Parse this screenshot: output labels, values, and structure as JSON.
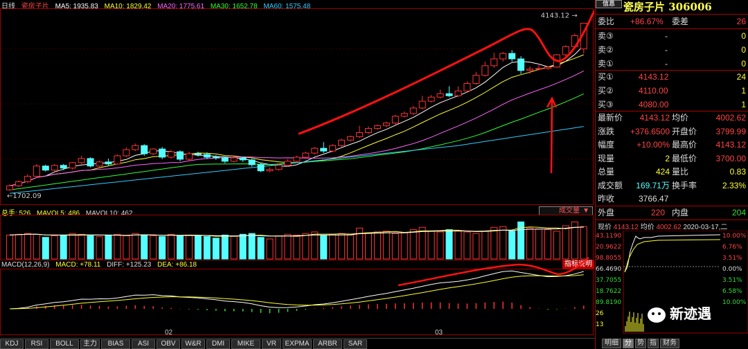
{
  "header": {
    "period": "日线",
    "stock": "瓷房子片",
    "ma": [
      {
        "label": "MA5: 1935.83",
        "color": "#ffffff"
      },
      {
        "label": "MA10: 1829.42",
        "color": "#ffff33"
      },
      {
        "label": "MA20: 1775.61",
        "color": "#ff66ff"
      },
      {
        "label": "MA30: 1652.78",
        "color": "#33ff33"
      },
      {
        "label": "MA60: 1575.48",
        "color": "#33ccff"
      }
    ]
  },
  "kline": {
    "high_label": "4143.12",
    "low_label": "1702.09",
    "candles": [
      [
        1702,
        1760,
        1690,
        1780
      ],
      [
        1760,
        1820,
        1740,
        1840
      ],
      [
        1820,
        1900,
        1800,
        1930
      ],
      [
        1900,
        2050,
        1880,
        2080
      ],
      [
        2050,
        1990,
        1970,
        2070
      ],
      [
        1990,
        2060,
        1970,
        2080
      ],
      [
        2060,
        2020,
        1990,
        2080
      ],
      [
        2020,
        2100,
        2000,
        2110
      ],
      [
        2100,
        2160,
        2080,
        2200
      ],
      [
        2160,
        2050,
        2030,
        2180
      ],
      [
        2050,
        2110,
        2040,
        2130
      ],
      [
        2110,
        2080,
        2060,
        2160
      ],
      [
        2080,
        2200,
        2070,
        2220
      ],
      [
        2200,
        2290,
        2180,
        2320
      ],
      [
        2290,
        2350,
        2270,
        2380
      ],
      [
        2350,
        2230,
        2200,
        2370
      ],
      [
        2230,
        2300,
        2210,
        2310
      ],
      [
        2300,
        2180,
        2150,
        2330
      ],
      [
        2180,
        2260,
        2160,
        2280
      ],
      [
        2260,
        2150,
        2120,
        2280
      ],
      [
        2150,
        2230,
        2120,
        2260
      ],
      [
        2230,
        2220,
        2190,
        2260
      ],
      [
        2220,
        2180,
        2150,
        2250
      ],
      [
        2180,
        2170,
        2140,
        2210
      ],
      [
        2170,
        2120,
        2090,
        2190
      ],
      [
        2120,
        2170,
        2100,
        2190
      ],
      [
        2170,
        2140,
        2110,
        2190
      ],
      [
        2140,
        2070,
        2040,
        2160
      ],
      [
        2070,
        1980,
        1960,
        2090
      ],
      [
        1980,
        2000,
        1960,
        2030
      ],
      [
        2000,
        2060,
        1980,
        2080
      ],
      [
        2060,
        2120,
        2040,
        2150
      ],
      [
        2120,
        2180,
        2100,
        2200
      ],
      [
        2180,
        2240,
        2160,
        2260
      ],
      [
        2240,
        2310,
        2220,
        2330
      ],
      [
        2310,
        2270,
        2240,
        2400
      ],
      [
        2270,
        2350,
        2250,
        2370
      ],
      [
        2350,
        2430,
        2330,
        2450
      ],
      [
        2430,
        2480,
        2410,
        2500
      ],
      [
        2480,
        2540,
        2460,
        2640
      ],
      [
        2540,
        2600,
        2520,
        2630
      ],
      [
        2600,
        2640,
        2580,
        2660
      ],
      [
        2640,
        2680,
        2620,
        2700
      ],
      [
        2680,
        2780,
        2660,
        2800
      ],
      [
        2780,
        2820,
        2760,
        2850
      ],
      [
        2820,
        2900,
        2800,
        2930
      ],
      [
        2900,
        3000,
        2880,
        3080
      ],
      [
        3000,
        3060,
        2980,
        3090
      ],
      [
        3060,
        3110,
        3040,
        3170
      ],
      [
        3110,
        3080,
        3060,
        3220
      ],
      [
        3080,
        3150,
        3060,
        3220
      ],
      [
        3150,
        3260,
        3130,
        3290
      ],
      [
        3260,
        3380,
        3240,
        3430
      ],
      [
        3380,
        3520,
        3360,
        3580
      ],
      [
        3520,
        3620,
        3490,
        3710
      ],
      [
        3620,
        3700,
        3580,
        3720
      ],
      [
        3700,
        3620,
        3580,
        3750
      ],
      [
        3620,
        3450,
        3400,
        3660
      ],
      [
        3450,
        3470,
        3400,
        3510
      ],
      [
        3470,
        3480,
        3450,
        3550
      ],
      [
        3480,
        3500,
        3460,
        3510
      ],
      [
        3500,
        3680,
        3490,
        3690
      ],
      [
        3680,
        3800,
        3620,
        3820
      ],
      [
        3800,
        3960,
        3780,
        3990
      ],
      [
        3766,
        4143,
        3700,
        4143
      ]
    ]
  },
  "volume": {
    "label_total": "总手: 526",
    "label_mavol5": "MAVOL5: 486",
    "label_mavol10": "MAVOL10: 462",
    "select_label": "成交量",
    "bars": [
      310,
      320,
      330,
      320,
      280,
      300,
      310,
      330,
      320,
      300,
      290,
      310,
      320,
      300,
      330,
      310,
      300,
      290,
      320,
      300,
      310,
      300,
      290,
      270,
      310,
      300,
      320,
      330,
      280,
      260,
      300,
      320,
      310,
      330,
      350,
      300,
      320,
      330,
      310,
      400,
      340,
      350,
      360,
      330,
      340,
      380,
      410,
      360,
      350,
      380,
      360,
      350,
      330,
      360,
      410,
      420,
      360,
      480,
      400,
      390,
      380,
      360,
      430,
      480,
      420
    ]
  },
  "macd": {
    "label_name": "MACD(12,26,9)",
    "label_macd": "MACD: +78.11",
    "label_diff": "DIFF: +125.23",
    "label_dea": "DEA: +86.18",
    "hint": "指标说明",
    "axis_02": "02",
    "axis_03": "03"
  },
  "panel": {
    "tab": "信息",
    "title": "瓷房子片 306006",
    "weibi_label": "委比",
    "weibi_value": "+86.67%",
    "weicha_label": "委差",
    "weicha_value": "26",
    "sell": [
      {
        "label": "卖③",
        "price": "-",
        "vol": "0"
      },
      {
        "label": "卖②",
        "price": "-",
        "vol": "0"
      },
      {
        "label": "卖①",
        "price": "-",
        "vol": "0"
      }
    ],
    "buy": [
      {
        "label": "买①",
        "price": "4143.12",
        "vol": "24"
      },
      {
        "label": "买②",
        "price": "4110.00",
        "vol": "1"
      },
      {
        "label": "买③",
        "price": "4080.00",
        "vol": "1"
      }
    ],
    "quotes": [
      {
        "l1": "最新价",
        "v1": "4143.12",
        "c1": "red",
        "l2": "均价",
        "v2": "4002.62",
        "c2": "red"
      },
      {
        "l1": "涨跌",
        "v1": "+376.6500",
        "c1": "red",
        "l2": "开盘价",
        "v2": "3799.99",
        "c2": "red"
      },
      {
        "l1": "幅度",
        "v1": "+10.00%",
        "c1": "red",
        "l2": "最高价",
        "v2": "4143.12",
        "c2": "red"
      },
      {
        "l1": "现量",
        "v1": "2",
        "c1": "yellow",
        "l2": "最低价",
        "v2": "3700.00",
        "c2": "red"
      },
      {
        "l1": "总量",
        "v1": "424",
        "c1": "yellow",
        "l2": "量比",
        "v2": "0.83",
        "c2": "yellow"
      },
      {
        "l1": "成交额",
        "v1": "169.71万",
        "c1": "cyan",
        "l2": "换手率",
        "v2": "2.33%",
        "c2": "yellow"
      }
    ],
    "zuoshou_label": "昨收",
    "zuoshou_value": "3766.47",
    "waipan_label": "外盘",
    "waipan_value": "220",
    "neipan_label": "内盘",
    "neipan_value": "204",
    "mini_header": {
      "label1": "现价",
      "v1": "4143.12",
      "label2": "均价",
      "v2": "4002.62",
      "date": "2020-03-17,二"
    },
    "mini_left": [
      "43.1190",
      "20.9622",
      "98.8055",
      "66.4690",
      "37.7055",
      "18.7622",
      "89.8190",
      "26",
      "13"
    ],
    "mini_right": [
      "10.00%",
      "6.76%",
      "3.51%",
      "0.00%",
      "3.51%",
      "6.58%",
      "10.00%"
    ],
    "watermark": "新迹遇"
  },
  "tabs": [
    "KDJ",
    "RSI",
    "BOLL",
    "主力",
    "BIAS",
    "ASI",
    "OBV",
    "W&R",
    "DMI",
    "MIKE",
    "VR",
    "EXPMA",
    "ARBR",
    "SAR"
  ],
  "right_tabs": [
    "明细",
    "分",
    "势",
    "指",
    "财务"
  ],
  "colors": {
    "up": "#ff3333",
    "down": "#55ffff",
    "annotation": "#ff1111"
  }
}
